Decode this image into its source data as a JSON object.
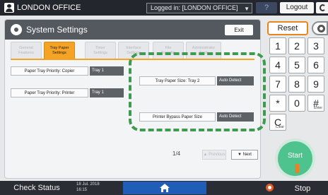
{
  "topbar": {
    "user_name": "LONDON OFFICE",
    "login_status": "Logged in: [LONDON OFFICE]",
    "help_label": "?",
    "logout_label": "Logout"
  },
  "panel": {
    "title": "System Settings",
    "exit_label": "Exit",
    "tabs": [
      {
        "label_line1": "General",
        "label_line2": "Features"
      },
      {
        "label_line1": "Tray Paper",
        "label_line2": "Settings"
      },
      {
        "label_line1": "Timer",
        "label_line2": "Settings"
      },
      {
        "label_line1": "Interface",
        "label_line2": "Settings"
      },
      {
        "label_line1": "File",
        "label_line2": "Transfer"
      },
      {
        "label_line1": "Administrator",
        "label_line2": "Tools"
      }
    ],
    "settings": [
      {
        "label": "Paper Tray Priority: Copier",
        "value": "Tray 1"
      },
      {
        "label": "Paper Tray Priority: Printer",
        "value": "Tray 1"
      },
      {
        "label": "Tray Paper Size: Tray 2",
        "value": "Auto Detect"
      },
      {
        "label": "Printer Bypass Paper Size",
        "value": "Auto Detect"
      }
    ],
    "page_indicator": "1/4",
    "prev_label": "▲ Previous",
    "next_label": "▼ Next"
  },
  "keypad": {
    "reset_label": "Reset",
    "keys": [
      {
        "main": "1",
        "sub": ""
      },
      {
        "main": "2",
        "sub": ""
      },
      {
        "main": "3",
        "sub": ""
      },
      {
        "main": "4",
        "sub": ""
      },
      {
        "main": "5",
        "sub": ""
      },
      {
        "main": "6",
        "sub": ""
      },
      {
        "main": "7",
        "sub": ""
      },
      {
        "main": "8",
        "sub": ""
      },
      {
        "main": "9",
        "sub": ""
      },
      {
        "main": "*",
        "sub": ""
      },
      {
        "main": "0",
        "sub": ""
      },
      {
        "main": "#",
        "sub": "Enter"
      },
      {
        "main": "C",
        "sub": "Clear"
      }
    ],
    "start_label": "Start"
  },
  "statusbar": {
    "check_status_label": "Check Status",
    "date": "18 Jul. 2018",
    "time": "16:15",
    "stop_label": "Stop"
  },
  "colors": {
    "accent_orange": "#f5a324",
    "start_green": "#4ec38e",
    "highlight_green": "#3d9a4f",
    "home_blue": "#1f5db8"
  }
}
